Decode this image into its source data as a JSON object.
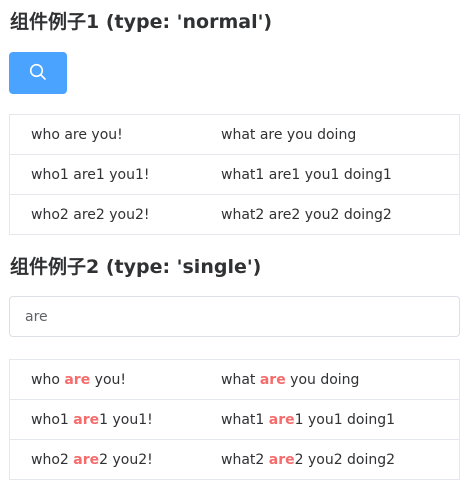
{
  "section1": {
    "title": "组件例子1 (type: 'normal')",
    "search_button_icon": "search-icon",
    "rows": [
      {
        "col1": "who are you!",
        "col2": "what are you doing"
      },
      {
        "col1": "who1 are1 you1!",
        "col2": "what1 are1 you1 doing1"
      },
      {
        "col1": "who2 are2 you2!",
        "col2": "what2 are2 you2 doing2"
      }
    ]
  },
  "section2": {
    "title": "组件例子2 (type: 'single')",
    "search_value": "are",
    "highlight_color": "#f56c6c",
    "rows": [
      {
        "col1": "who are you!",
        "col2": "what are you doing"
      },
      {
        "col1": "who1 are1 you1!",
        "col2": "what1 are1 you1 doing1"
      },
      {
        "col1": "who2 are2 you2!",
        "col2": "what2 are2 you2 doing2"
      }
    ]
  },
  "colors": {
    "primary": "#4aa3ff",
    "border": "#e4e7ed",
    "text": "#303133"
  }
}
